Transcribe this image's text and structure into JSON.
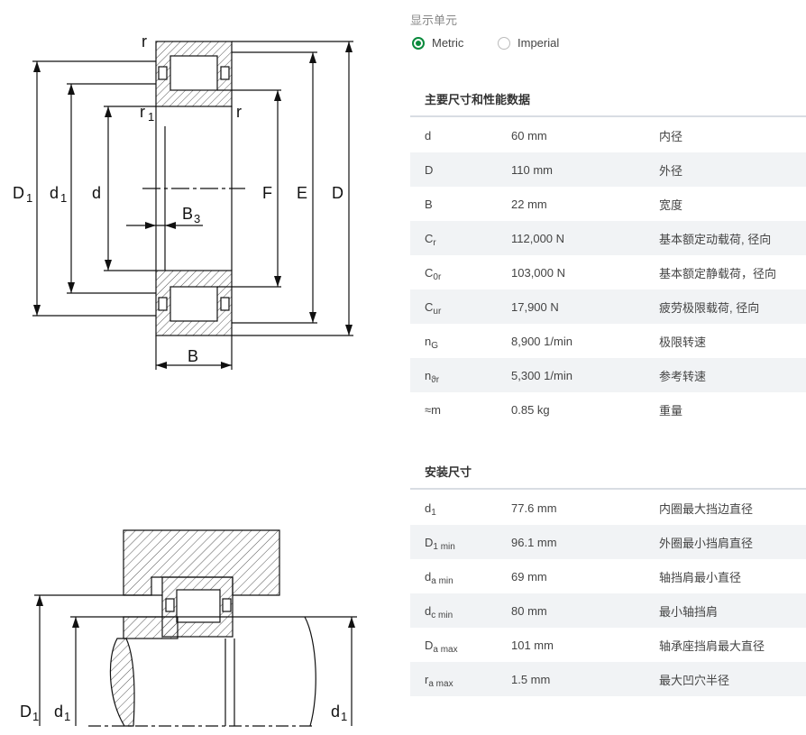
{
  "unit_selector": {
    "label": "显示单元",
    "options": [
      {
        "label": "Metric",
        "selected": true
      },
      {
        "label": "Imperial",
        "selected": false
      }
    ]
  },
  "dimensions_section": {
    "title": "主要尺寸和性能数据",
    "rows": [
      {
        "symbol": "d",
        "sub": "",
        "value": "60 mm",
        "desc": "内径"
      },
      {
        "symbol": "D",
        "sub": "",
        "value": "110 mm",
        "desc": "外径"
      },
      {
        "symbol": "B",
        "sub": "",
        "value": "22 mm",
        "desc": "宽度"
      },
      {
        "symbol": "C",
        "sub": "r",
        "value": "112,000 N",
        "desc": "基本额定动载荷, 径向"
      },
      {
        "symbol": "C",
        "sub": "0r",
        "value": "103,000 N",
        "desc": "基本额定静载荷，径向"
      },
      {
        "symbol": "C",
        "sub": "ur",
        "value": "17,900 N",
        "desc": "疲劳极限载荷, 径向"
      },
      {
        "symbol": "n",
        "sub": "G",
        "value": "8,900 1/min",
        "desc": "极限转速"
      },
      {
        "symbol": "n",
        "sub": "ϑr",
        "value": "5,300 1/min",
        "desc": "参考转速"
      },
      {
        "symbol": "≈m",
        "sub": "",
        "value": "0.85 kg",
        "desc": "重量"
      }
    ]
  },
  "mounting_section": {
    "title": "安装尺寸",
    "rows": [
      {
        "symbol": "d",
        "sub": "1",
        "value": "77.6 mm",
        "desc": "内圈最大挡边直径"
      },
      {
        "symbol": "D",
        "sub": "1 min",
        "value": "96.1 mm",
        "desc": "外圈最小挡肩直径"
      },
      {
        "symbol": "d",
        "sub": "a min",
        "value": "69 mm",
        "desc": "轴挡肩最小直径"
      },
      {
        "symbol": "d",
        "sub": "c min",
        "value": "80 mm",
        "desc": "最小轴挡肩"
      },
      {
        "symbol": "D",
        "sub": "a max",
        "value": "101 mm",
        "desc": "轴承座挡肩最大直径"
      },
      {
        "symbol": "r",
        "sub": "a max",
        "value": "1.5 mm",
        "desc": "最大凹穴半径"
      }
    ]
  },
  "diagram_top_labels": {
    "r_top": "r",
    "r1": "r",
    "r1_sub": "1",
    "r_right": "r",
    "D1": "D",
    "D1_sub": "1",
    "d1": "d",
    "d1_sub": "1",
    "d": "d",
    "B3": "B",
    "B3_sub": "3",
    "F": "F",
    "E": "E",
    "D": "D",
    "B": "B"
  },
  "diagram_bottom_labels": {
    "D1": "D",
    "D1_sub": "1",
    "d1_left": "d",
    "d1_left_sub": "1",
    "d1_right": "d",
    "d1_right_sub": "1"
  },
  "colors": {
    "accent": "#0a8a3c"
  }
}
